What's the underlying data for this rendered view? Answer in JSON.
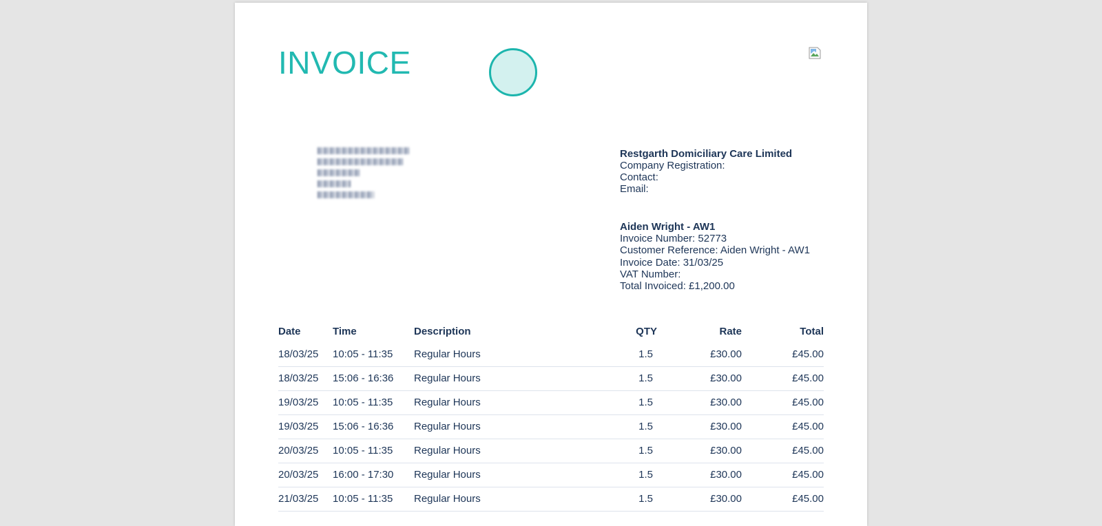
{
  "invoice": {
    "title": "INVOICE",
    "company": {
      "name": "Restgarth Domiciliary Care Limited",
      "registration_label": "Company Registration:",
      "contact_label": "Contact:",
      "email_label": "Email:"
    },
    "customer": {
      "name": "Aiden Wright - AW1",
      "invoice_number": "Invoice Number: 52773",
      "customer_reference": "Customer Reference: Aiden Wright - AW1",
      "invoice_date": "Invoice Date: 31/03/25",
      "vat_number": "VAT Number:",
      "total_invoiced": "Total Invoiced: £1,200.00"
    },
    "table": {
      "headers": [
        "Date",
        "Time",
        "Description",
        "QTY",
        "Rate",
        "Total"
      ],
      "rows": [
        [
          "18/03/25",
          "10:05 - 11:35",
          "Regular Hours",
          "1.5",
          "£30.00",
          "£45.00"
        ],
        [
          "18/03/25",
          "15:06 - 16:36",
          "Regular Hours",
          "1.5",
          "£30.00",
          "£45.00"
        ],
        [
          "19/03/25",
          "10:05 - 11:35",
          "Regular Hours",
          "1.5",
          "£30.00",
          "£45.00"
        ],
        [
          "19/03/25",
          "15:06 - 16:36",
          "Regular Hours",
          "1.5",
          "£30.00",
          "£45.00"
        ],
        [
          "20/03/25",
          "10:05 - 11:35",
          "Regular Hours",
          "1.5",
          "£30.00",
          "£45.00"
        ],
        [
          "20/03/25",
          "16:00 - 17:30",
          "Regular Hours",
          "1.5",
          "£30.00",
          "£45.00"
        ],
        [
          "21/03/25",
          "10:05 - 11:35",
          "Regular Hours",
          "1.5",
          "£30.00",
          "£45.00"
        ]
      ]
    }
  },
  "colors": {
    "accent": "#22b9b1",
    "text": "#1d3557",
    "background": "#e5e5e5"
  },
  "icons": {
    "logo": "broken-image-icon"
  }
}
